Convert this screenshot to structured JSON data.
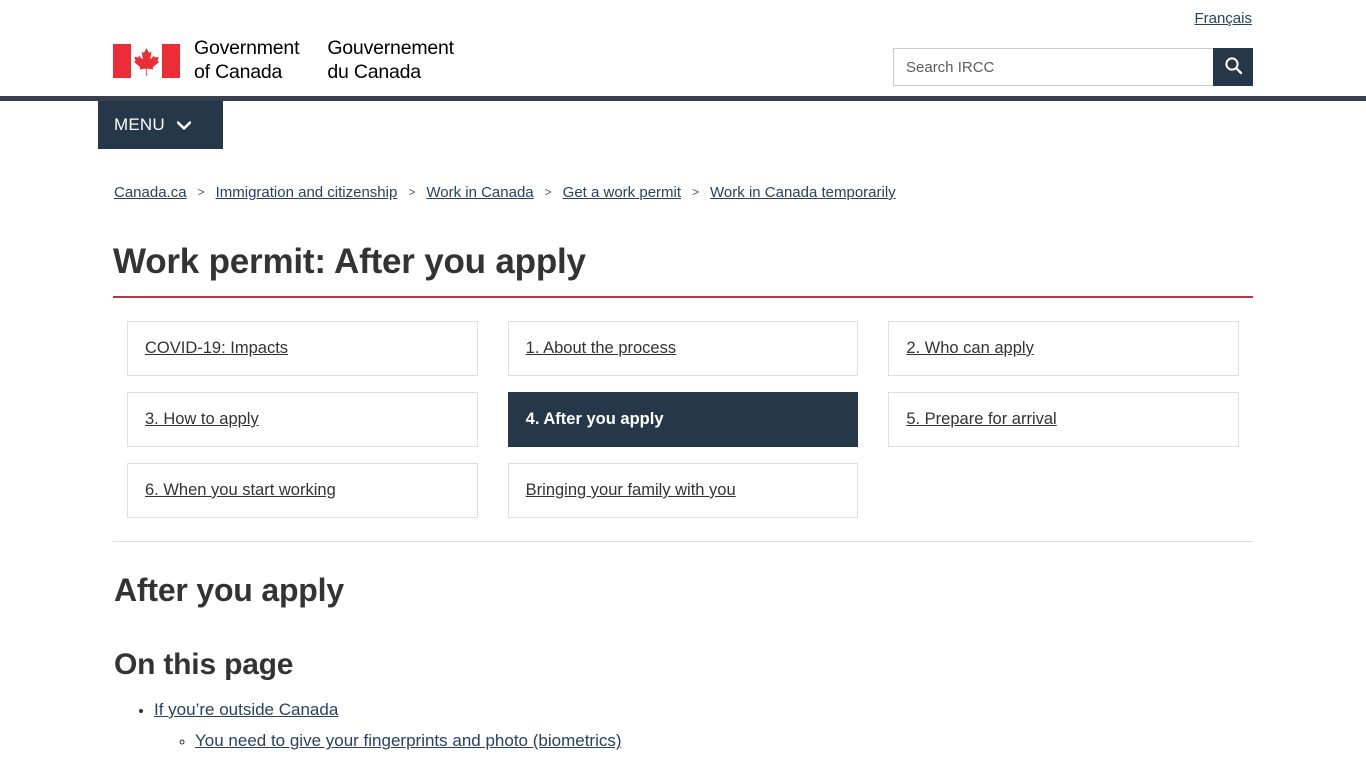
{
  "header": {
    "lang_toggle": "Français",
    "wordmark_en_line1": "Government",
    "wordmark_en_line2": "of Canada",
    "wordmark_fr_line1": "Gouvernement",
    "wordmark_fr_line2": "du Canada",
    "search_placeholder": "Search IRCC",
    "search_value": "",
    "search_icon": "search-icon",
    "menu_label": "MENU",
    "menu_icon": "chevron-down-icon",
    "flag_icon": "canada-flag-icon"
  },
  "breadcrumb": {
    "separator": ">",
    "items": [
      {
        "label": "Canada.ca"
      },
      {
        "label": "Immigration and citizenship"
      },
      {
        "label": "Work in Canada"
      },
      {
        "label": "Get a work permit"
      },
      {
        "label": "Work in Canada temporarily"
      }
    ]
  },
  "page": {
    "title": "Work permit: After you apply",
    "section_heading": "After you apply",
    "on_this_page_heading": "On this page"
  },
  "steps": [
    {
      "label": "COVID-19: Impacts",
      "active": false
    },
    {
      "label": "1. About the process",
      "active": false
    },
    {
      "label": "2. Who can apply",
      "active": false
    },
    {
      "label": "3. How to apply",
      "active": false
    },
    {
      "label": "4. After you apply",
      "active": true
    },
    {
      "label": "5. Prepare for arrival",
      "active": false
    },
    {
      "label": "6. When you start working",
      "active": false
    },
    {
      "label": "Bringing your family with you",
      "active": false
    },
    {
      "label": "",
      "active": false
    }
  ],
  "on_this_page": [
    {
      "label": "If you’re outside Canada",
      "children": [
        {
          "label": "You need to give your fingerprints and photo (biometrics)"
        }
      ]
    }
  ],
  "colors": {
    "nav_dark": "#26374A",
    "header_rule": "#38414D",
    "title_rule": "#AF3C43",
    "link_blue": "#284162",
    "flag_red": "#EA2D37",
    "tile_border": "#dfdfdf"
  }
}
